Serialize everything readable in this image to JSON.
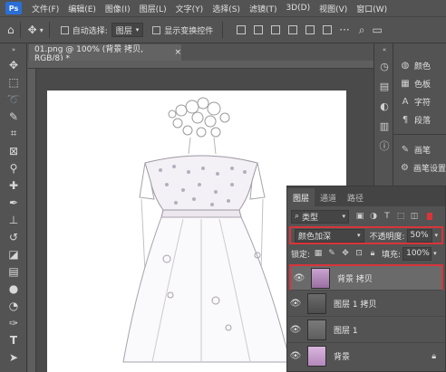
{
  "menubar": {
    "logo": "Ps",
    "items": [
      "文件(F)",
      "编辑(E)",
      "图像(I)",
      "图层(L)",
      "文字(Y)",
      "选择(S)",
      "滤镜(T)",
      "3D(D)",
      "视图(V)",
      "窗口(W)"
    ]
  },
  "options": {
    "auto_select_label": "自动选择:",
    "auto_select_value": "图层",
    "show_transform_label": "显示变换控件"
  },
  "document": {
    "tab_title": "01.png @ 100% (背景 拷贝, RGB/8) *",
    "close": "×"
  },
  "dock": {
    "items": [
      {
        "icon": "palette-icon",
        "label": "颜色"
      },
      {
        "icon": "swatches-icon",
        "label": "色板"
      },
      {
        "icon": "character-icon",
        "label": "字符"
      },
      {
        "icon": "paragraph-icon",
        "label": "段落"
      },
      {
        "icon": "brush-icon",
        "label": "画笔"
      },
      {
        "icon": "brush-settings-icon",
        "label": "画笔设置"
      }
    ]
  },
  "layers_panel": {
    "tabs": [
      "图层",
      "通道",
      "路径"
    ],
    "filter_kind": "类型",
    "blend_mode": "颜色加深",
    "opacity_label": "不透明度:",
    "opacity_value": "50%",
    "lock_label": "锁定:",
    "fill_label": "填充:",
    "fill_value": "100%",
    "layers": [
      {
        "name": "背景 拷贝",
        "selected": true
      },
      {
        "name": "图层 1 拷贝",
        "selected": false
      },
      {
        "name": "图层 1",
        "selected": false
      },
      {
        "name": "背景",
        "selected": false
      }
    ]
  },
  "colors": {
    "highlight": "#d9343a",
    "ps_blue": "#2b6fd6"
  }
}
